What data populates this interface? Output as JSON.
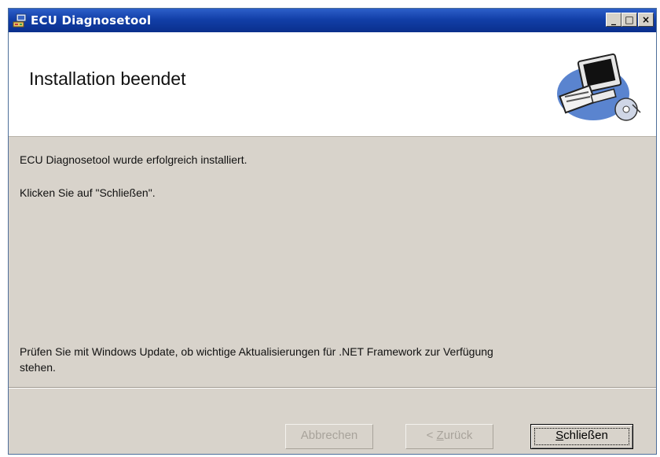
{
  "window": {
    "title": "ECU Diagnosetool",
    "controls": [
      "_",
      "□",
      "×"
    ]
  },
  "header": {
    "title": "Installation beendet",
    "art_icon": "computer-setup-icon"
  },
  "content": {
    "line1": "ECU Diagnosetool wurde erfolgreich installiert.",
    "line2": "Klicken Sie auf \"Schließen\".",
    "line3": "Prüfen Sie mit Windows Update, ob wichtige Aktualisierungen für .NET Framework zur Verfügung",
    "line4": "stehen."
  },
  "buttons": {
    "cancel": "Abbrechen",
    "back_prefix": "< ",
    "back_accel": "Z",
    "back_rest": "urück",
    "close_accel": "S",
    "close_rest": "chließen"
  }
}
